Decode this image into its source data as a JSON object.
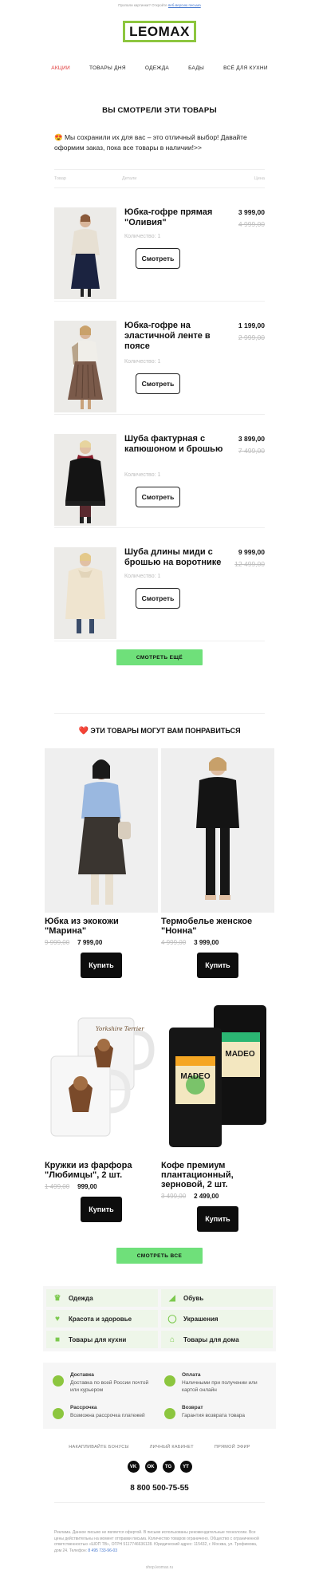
{
  "preheader": {
    "text": "Пропали картинки? Откройте",
    "link": "веб-версию письма"
  },
  "logo": {
    "text": "LEOMAX"
  },
  "nav": [
    "АКЦИИ",
    "ТОВАРЫ ДНЯ",
    "ОДЕЖДА",
    "БАДЫ",
    "ВСЁ ДЛЯ КУХНИ"
  ],
  "viewed": {
    "title": "ВЫ СМОТРЕЛИ ЭТИ ТОВАРЫ",
    "intro": "😍 Мы сохранили их для вас – это отличный выбор! Давайте оформим заказ, пока все товары в наличии!>>",
    "headers": [
      "Товар",
      "Детали",
      "Цена"
    ],
    "items": [
      {
        "name": "Юбка-гофре прямая \"Оливия\"",
        "qty": "Количество: 1",
        "button": "Смотреть",
        "price": "3 999,00",
        "old_price": "4 999,00"
      },
      {
        "name": "Юбка-гофре на эластичной ленте в поясе",
        "qty": "Количество: 1",
        "button": "Смотреть",
        "price": "1 199,00",
        "old_price": "2 999,00"
      },
      {
        "name": "Шуба фактурная с капюшоном и брошью",
        "qty": "Количество: 1",
        "button": "Смотреть",
        "price": "3 899,00",
        "old_price": "7 499,00"
      },
      {
        "name": "Шуба длины миди с брошью на воротнике",
        "qty": "Количество: 1",
        "button": "Смотреть",
        "price": "9 999,00",
        "old_price": "12 499,00"
      }
    ],
    "more_button": "СМОТРЕТЬ ЕЩЁ"
  },
  "recommend": {
    "title": "ЭТИ ТОВАРЫ МОГУТ ВАМ ПОНРАВИТЬСЯ",
    "heart": "❤️",
    "products": [
      {
        "name": "Юбка из экокожи \"Марина\"",
        "old_price": "9 999,00",
        "price": "7 999,00",
        "button": "Купить"
      },
      {
        "name": "Термобелье женское \"Нонна\"",
        "old_price": "4 999,00",
        "price": "3 999,00",
        "button": "Купить"
      },
      {
        "name": "Кружки из фарфора \"Любимцы\", 2 шт.",
        "old_price": "1 499,00",
        "price": "999,00",
        "button": "Купить"
      },
      {
        "name": "Кофе премиум плантационный, зерновой, 2 шт.",
        "old_price": "3 499,00",
        "price": "2 499,00",
        "button": "Купить"
      }
    ],
    "all_button": "СМОТРЕТЬ ВСЕ",
    "mug_text": "Yorkshire Terrier",
    "coffee_brand": "MADEO"
  },
  "categories": [
    {
      "label": "Одежда",
      "icon": "dress-icon"
    },
    {
      "label": "Обувь",
      "icon": "shoe-icon"
    },
    {
      "label": "Красота и здоровье",
      "icon": "heart-icon"
    },
    {
      "label": "Украшения",
      "icon": "ring-icon"
    },
    {
      "label": "Товары для кухни",
      "icon": "pot-icon"
    },
    {
      "label": "Товары для дома",
      "icon": "house-icon"
    }
  ],
  "benefits": [
    {
      "title": "Доставка",
      "desc": "Доставка по всей России почтой или курьером"
    },
    {
      "title": "Оплата",
      "desc": "Наличными при получении или картой онлайн"
    },
    {
      "title": "Рассрочка",
      "desc": "Возможна рассрочка платежей"
    },
    {
      "title": "Возврат",
      "desc": "Гарантия возврата товара"
    }
  ],
  "footer": {
    "links": [
      "НАКАПЛИВАЙТЕ БОНУСЫ",
      "ЛИЧНЫЙ КАБИНЕТ",
      "ПРЯМОЙ ЭФИР"
    ],
    "social": [
      "VK",
      "OK",
      "TG",
      "YT"
    ],
    "phone": "8 800 500-75-55",
    "legal": "Реклама. Данное письмо не является офертой. В письме использованы рекомендательные технологии. Все цены действительны на момент отправки письма. Количество товаров ограничено. Общество с ограниченной ответственностью «ШОП ТВ», ОГРН 5117746636128. Юридический адрес: 115432, г. Москва, ул. Трофимова, дом 24. Телефон:",
    "legal_phone": "8 495 733-96-03",
    "site": "shop.leomax.ru"
  },
  "colors": {
    "accent_green": "#8dc63f",
    "button_green": "#6fe07a",
    "nav_active": "#e03333"
  }
}
